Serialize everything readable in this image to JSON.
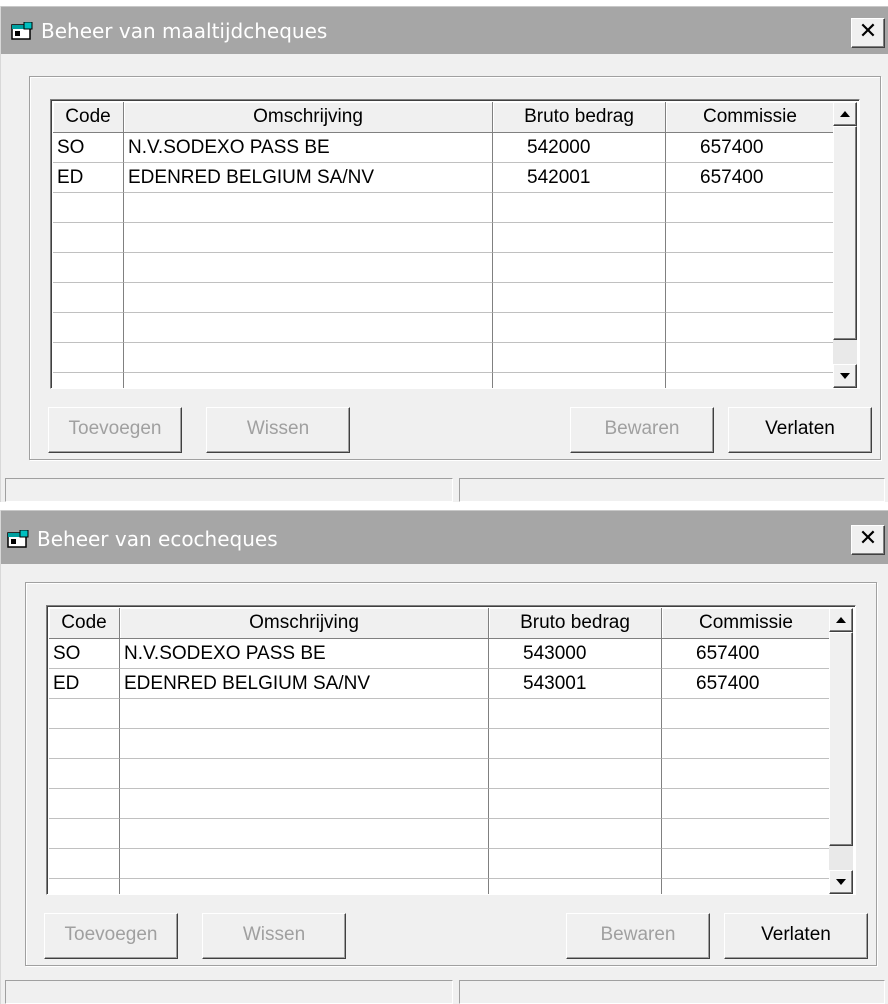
{
  "windows": [
    {
      "title": "Beheer van maaltijdcheques",
      "columns": [
        "Code",
        "Omschrijving",
        "Bruto bedrag",
        "Commissie"
      ],
      "rows": [
        [
          "SO",
          "N.V.SODEXO PASS BE",
          "542000",
          "657400"
        ],
        [
          "ED",
          "EDENRED BELGIUM SA/NV",
          "542001",
          "657400"
        ]
      ],
      "buttons": {
        "add": "Toevoegen",
        "delete": "Wissen",
        "save": "Bewaren",
        "quit": "Verlaten"
      },
      "close": "✕"
    },
    {
      "title": "Beheer van ecocheques",
      "columns": [
        "Code",
        "Omschrijving",
        "Bruto bedrag",
        "Commissie"
      ],
      "rows": [
        [
          "SO",
          "N.V.SODEXO PASS BE",
          "543000",
          "657400"
        ],
        [
          "ED",
          "EDENRED BELGIUM SA/NV",
          "543001",
          "657400"
        ]
      ],
      "buttons": {
        "add": "Toevoegen",
        "delete": "Wissen",
        "save": "Bewaren",
        "quit": "Verlaten"
      },
      "close": "✕"
    }
  ],
  "icons": {
    "title": "window-app-icon",
    "close": "close-icon",
    "up": "scroll-up-arrow-icon",
    "down": "scroll-down-arrow-icon"
  }
}
